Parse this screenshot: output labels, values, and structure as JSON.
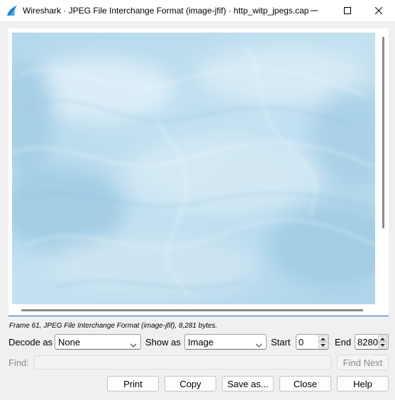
{
  "window": {
    "title": "Wireshark · JPEG File Interchange Format (image-jfif) · http_witp_jpegs.cap",
    "icon": "wireshark-fin-icon",
    "controls": [
      "minimize-icon",
      "maximize-icon",
      "close-icon"
    ]
  },
  "viewer": {
    "image_description_icon": "water-texture-image",
    "colors": {
      "image_base": "#b9dcef",
      "image_highlight": "#e2f1f9",
      "image_shadow": "#94c4de",
      "frame_accent": "#1f5f9f"
    }
  },
  "status": {
    "text": "Frame 61, JPEG File Interchange Format (image-jfif), 8,281 bytes."
  },
  "controls": {
    "decode_label": "Decode as",
    "decode_value": "None",
    "show_label": "Show as",
    "show_value": "Image",
    "start_label": "Start",
    "start_value": "0",
    "end_label": "End",
    "end_value": "8280"
  },
  "find": {
    "label": "Find:",
    "value": "",
    "next_label": "Find Next"
  },
  "buttons": {
    "print": "Print",
    "copy": "Copy",
    "save_as": "Save as...",
    "close": "Close",
    "help": "Help"
  }
}
